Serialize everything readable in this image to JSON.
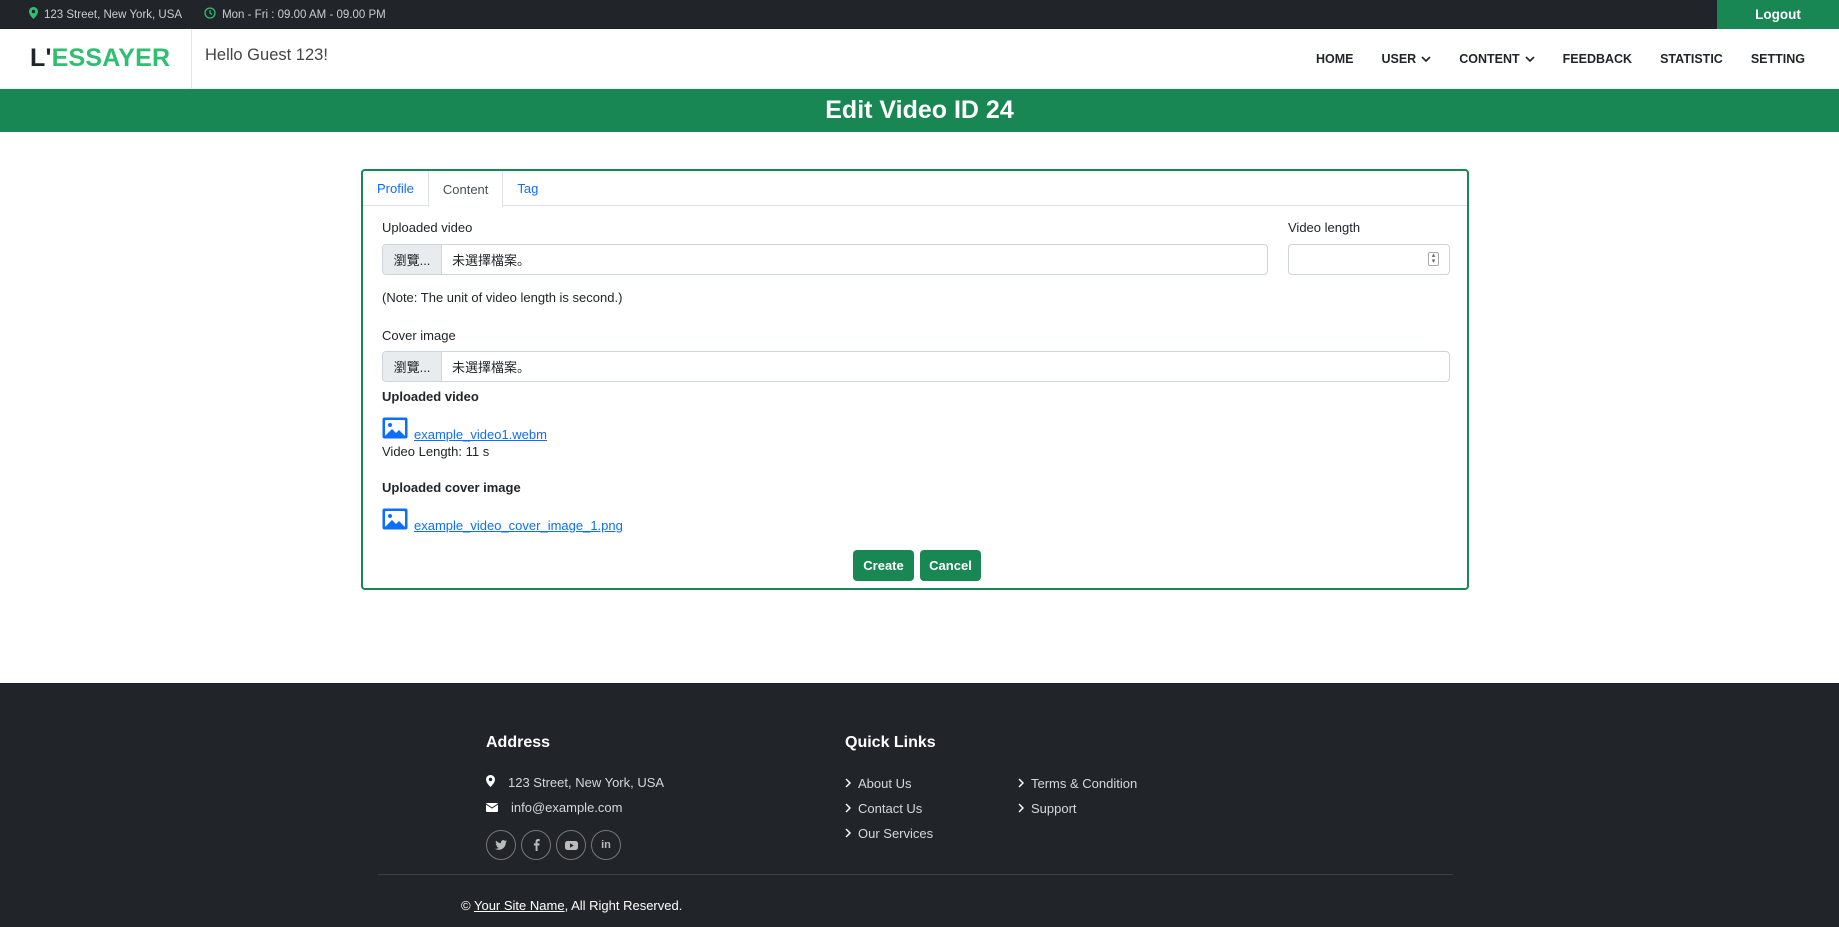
{
  "topbar": {
    "address": "123 Street, New York, USA",
    "hours": "Mon - Fri : 09.00 AM - 09.00 PM",
    "logout_label": "Logout"
  },
  "navbar": {
    "brand_part1": "L'",
    "brand_part2": "ESSAYER",
    "greeting": "Hello Guest 123!",
    "links": [
      "HOME",
      "USER",
      "CONTENT",
      "FEEDBACK",
      "STATISTIC",
      "SETTING"
    ]
  },
  "page": {
    "title": "Edit Video ID 24"
  },
  "tabs": [
    "Profile",
    "Content",
    "Tag"
  ],
  "form": {
    "uploaded_video_label": "Uploaded video",
    "video_length_label": "Video length",
    "browse_label": "瀏覽...",
    "no_file_text": "未選擇檔案。",
    "note": "(Note: The unit of video length is second.)",
    "cover_image_label": "Cover image",
    "uploaded_video_heading": "Uploaded video",
    "uploaded_video_file": "example_video1.webm",
    "video_length_text": "Video Length: 11 s",
    "uploaded_cover_heading": "Uploaded cover image",
    "uploaded_cover_file": "example_video_cover_image_1.png",
    "create_label": "Create",
    "cancel_label": "Cancel"
  },
  "footer": {
    "address_heading": "Address",
    "address": "123 Street, New York, USA",
    "email": "info@example.com",
    "quick_links_heading": "Quick Links",
    "links_col1": [
      "About Us",
      "Contact Us",
      "Our Services"
    ],
    "links_col2": [
      "Terms & Condition",
      "Support"
    ],
    "copyright_prefix": "©",
    "site_name": "Your Site Name",
    "copyright_suffix": ", All Right Reserved."
  },
  "colors": {
    "primary_green": "#198754",
    "brand_green": "#2fbf71",
    "dark": "#212529",
    "link_blue": "#0d6efd"
  }
}
